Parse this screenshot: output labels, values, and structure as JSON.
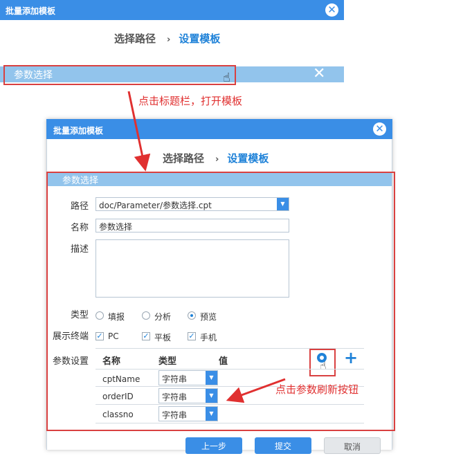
{
  "top_dialog": {
    "title": "批量添加模板",
    "steps": [
      "选择路径",
      "设置模板"
    ],
    "step_separator": "›",
    "panel_title": "参数选择",
    "panel_close": "✕"
  },
  "annotations": {
    "click_titlebar": "点击标题栏，打开模板",
    "click_refresh": "点击参数刷新按钮"
  },
  "dialog": {
    "title": "批量添加模板",
    "steps": [
      "选择路径",
      "设置模板"
    ],
    "step_separator": "›",
    "panel_title": "参数选择",
    "form": {
      "path_label": "路径",
      "path_value": "doc/Parameter/参数选择.cpt",
      "name_label": "名称",
      "name_value": "参数选择",
      "desc_label": "描述",
      "desc_value": "",
      "type_label": "类型",
      "type_options": [
        "填报",
        "分析",
        "预览"
      ],
      "type_selected": "预览",
      "terminal_label": "展示终端",
      "terminal_options": [
        "PC",
        "平板",
        "手机"
      ],
      "terminal_checked": [
        "PC",
        "平板",
        "手机"
      ],
      "params_label": "参数设置"
    },
    "param_table": {
      "headers": [
        "名称",
        "类型",
        "值"
      ],
      "rows": [
        {
          "name": "cptName",
          "type": "字符串"
        },
        {
          "name": "orderID",
          "type": "字符串"
        },
        {
          "name": "classno",
          "type": "字符串"
        }
      ]
    },
    "buttons": {
      "prev": "上一步",
      "submit": "提交",
      "cancel": "取消"
    }
  },
  "colors": {
    "accent": "#3a8ee6",
    "panel_bar": "#92c4ec",
    "annotation": "#e03030"
  }
}
